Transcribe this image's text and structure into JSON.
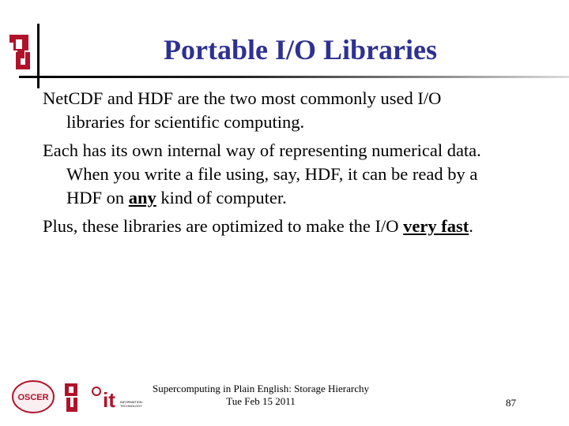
{
  "slide": {
    "title": "Portable I/O Libraries",
    "paragraphs": [
      {
        "line1": "NetCDF and HDF are the two most commonly used I/O",
        "line2": "libraries for scientific computing."
      },
      {
        "line1": "Each has its own internal way of representing numerical data.",
        "line2a": "When you write a file using, say, HDF, it can be read by a",
        "line3_pre": "HDF on ",
        "line3_em": "any",
        "line3_post": " kind of computer."
      },
      {
        "pre": "Plus, these libraries are optimized to make the I/O ",
        "em": "very fast",
        "post": "."
      }
    ]
  },
  "footer": {
    "line1": "Supercomputing in Plain English: Storage Hierarchy",
    "line2": "Tue Feb 15 2011",
    "page": "87",
    "logos": [
      "OSCER",
      "OU",
      "IT Information Technology"
    ]
  },
  "colors": {
    "title": "#2e3192",
    "ou_red": "#b0122a"
  }
}
